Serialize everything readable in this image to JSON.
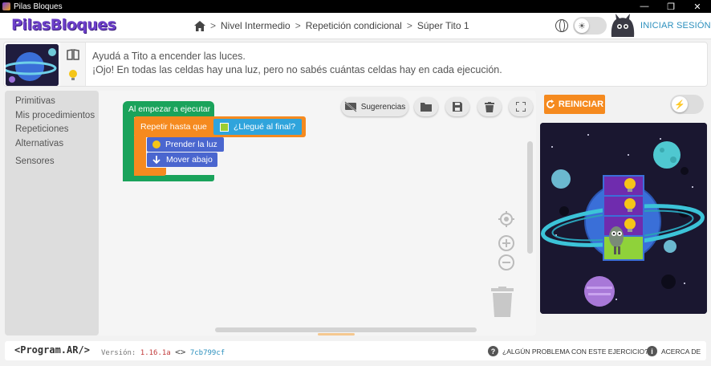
{
  "window": {
    "title": "Pilas Bloques",
    "minimize": "—",
    "maximize": "❐",
    "close": "✕"
  },
  "header": {
    "logo": "PilasBloques",
    "breadcrumb": [
      "Nivel Intermedio",
      "Repetición condicional",
      "Súper Tito 1"
    ],
    "separator": ">",
    "login": "INICIAR SESIÓN",
    "theme_icon": "sun-icon"
  },
  "instructions": {
    "line1": "Ayudá a Tito a encender las luces.",
    "line2": "¡Ojo! En todas las celdas hay una luz, pero no sabés cuántas celdas hay en cada ejecución."
  },
  "toolbox": {
    "categories": [
      "Primitivas",
      "Mis procedimientos",
      "Repeticiones",
      "Alternativas",
      "Sensores"
    ]
  },
  "workspace": {
    "hints_label": "Sugerencias",
    "blocks": {
      "start": "Al empezar a ejecutar",
      "repeat": "Repetir hasta que",
      "condition": "¿Llegué al final?",
      "action1": "Prender la luz",
      "action2": "Mover abajo"
    }
  },
  "run": {
    "label": "REINICIAR",
    "speed_icon": "lightning-icon"
  },
  "footer": {
    "brand": "<Program.AR/>",
    "version_label": "Versión:",
    "version": "1.16.1a",
    "commit": "7cb799cf",
    "help": "¿ALGÚN PROBLEMA CON ESTE EJERCICIO?",
    "about": "ACERCA DE"
  },
  "colors": {
    "brand_purple": "#6c3fc9",
    "event_green": "#1aa35b",
    "control_orange": "#f58a1f",
    "sensor_blue": "#2fa4dc",
    "primitive_blue": "#4a66cf",
    "restart_orange": "#f58a1f"
  }
}
